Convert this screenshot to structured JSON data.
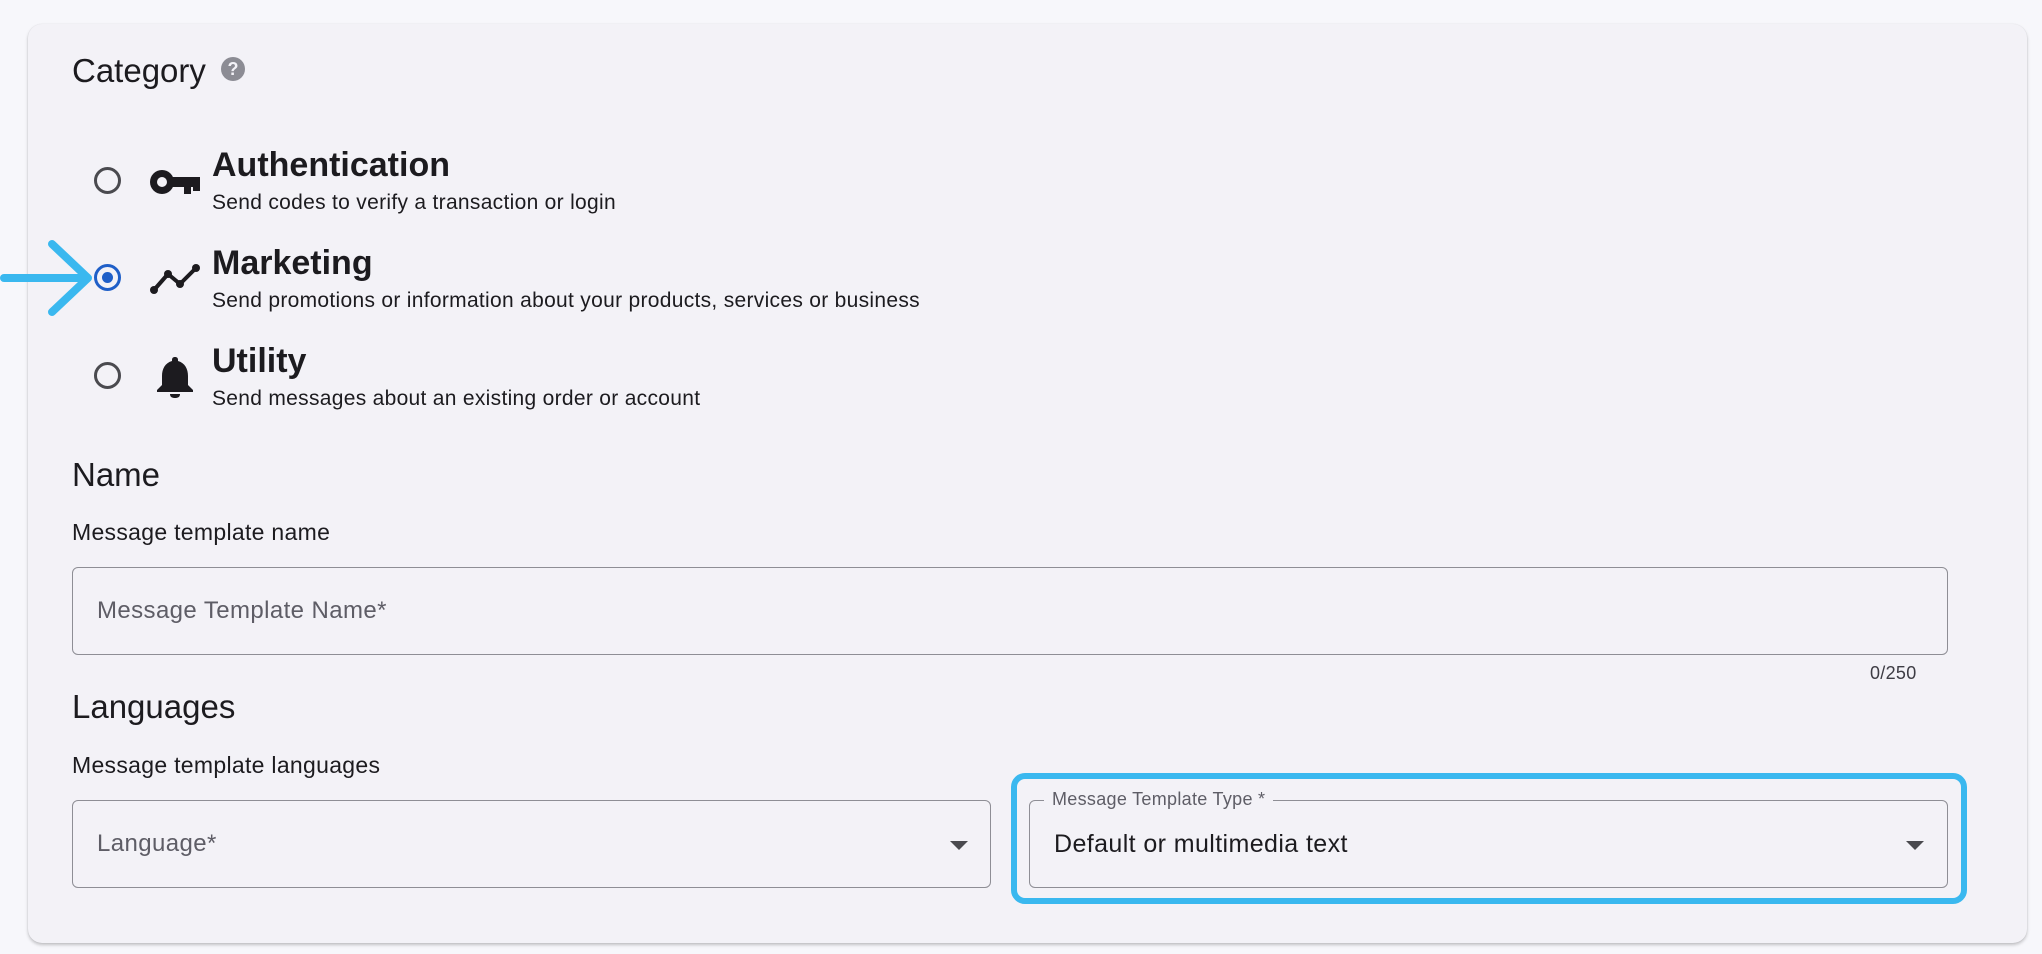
{
  "category": {
    "title": "Category",
    "help_icon": "help-circle-icon",
    "options": [
      {
        "title": "Authentication",
        "description": "Send codes to verify a transaction or login",
        "icon": "key-icon",
        "selected": false
      },
      {
        "title": "Marketing",
        "description": "Send promotions or information about your products, services or business",
        "icon": "trending-icon",
        "selected": true
      },
      {
        "title": "Utility",
        "description": "Send messages about an existing order or account",
        "icon": "bell-icon",
        "selected": false
      }
    ]
  },
  "name": {
    "title": "Name",
    "label": "Message template name",
    "placeholder": "Message Template Name*",
    "value": "",
    "counter": "0/250"
  },
  "languages": {
    "title": "Languages",
    "label": "Message template languages",
    "language_placeholder": "Language*",
    "type_label": "Message Template Type *",
    "type_value": "Default or multimedia text"
  },
  "colors": {
    "accent": "#1f5fc8",
    "highlight": "#3ab8ef",
    "card_background": "#f3f2f7"
  }
}
